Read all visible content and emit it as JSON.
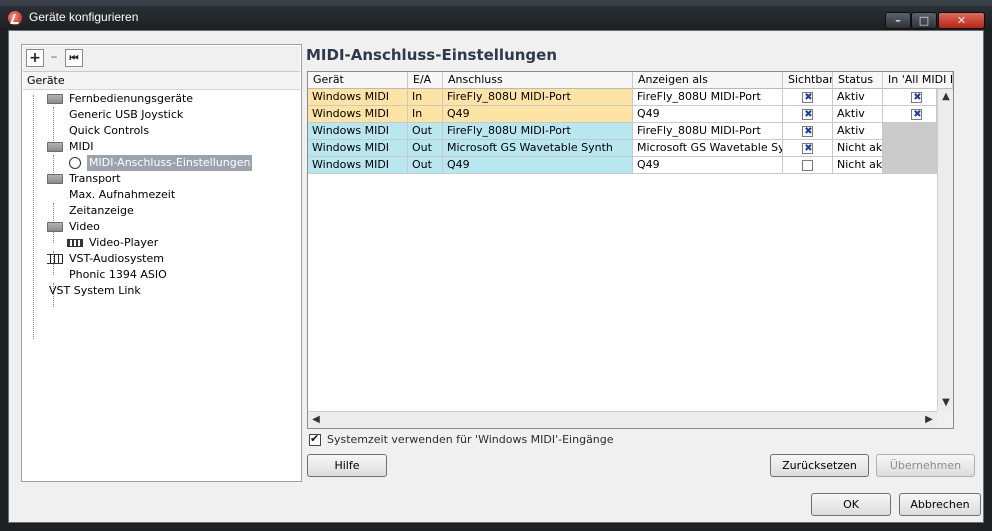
{
  "window": {
    "title": "Geräte konfigurieren",
    "controls": {
      "minimize": "–",
      "maximize": "□",
      "close": "✕"
    }
  },
  "toolbar": {
    "add": "+",
    "remove": "–",
    "reset": "⏮"
  },
  "tree": {
    "header": "Geräte",
    "items": [
      {
        "label": "Fernbedienungsgeräte",
        "icon": "folder-icon"
      },
      {
        "label": "Generic   USB  Joystick"
      },
      {
        "label": "Quick Controls"
      },
      {
        "label": "MIDI",
        "icon": "folder-icon"
      },
      {
        "label": "MIDI-Anschluss-Einstellungen",
        "icon": "midi-port-icon",
        "selected": true
      },
      {
        "label": "Transport",
        "icon": "folder-icon"
      },
      {
        "label": "Max. Aufnahmezeit"
      },
      {
        "label": "Zeitanzeige"
      },
      {
        "label": "Video",
        "icon": "folder-icon"
      },
      {
        "label": "Video-Player",
        "icon": "video-icon"
      },
      {
        "label": "VST-Audiosystem",
        "icon": "vst-icon"
      },
      {
        "label": "Phonic 1394 ASIO"
      },
      {
        "label": "VST System Link"
      }
    ]
  },
  "main": {
    "title": "MIDI-Anschluss-Einstellungen",
    "columns": [
      "Gerät",
      "E/A",
      "Anschluss",
      "Anzeigen als",
      "Sichtbar",
      "Status",
      "In 'All MIDI Inputs'"
    ],
    "rows": [
      {
        "geraet": "Windows MIDI",
        "ea": "In",
        "anschluss": "FireFly_808U MIDI-Port",
        "anzeigen": "FireFly_808U MIDI-Port",
        "sichtbar": true,
        "status": "Aktiv",
        "allmidi": true
      },
      {
        "geraet": "Windows MIDI",
        "ea": "In",
        "anschluss": "Q49",
        "anzeigen": "Q49",
        "sichtbar": true,
        "status": "Aktiv",
        "allmidi": true
      },
      {
        "geraet": "Windows MIDI",
        "ea": "Out",
        "anschluss": "FireFly_808U MIDI-Port",
        "anzeigen": "FireFly_808U MIDI-Port",
        "sichtbar": true,
        "status": "Aktiv",
        "allmidi": null
      },
      {
        "geraet": "Windows MIDI",
        "ea": "Out",
        "anschluss": "Microsoft GS Wavetable Synth",
        "anzeigen": "Microsoft GS Wavetable Synth",
        "sichtbar": true,
        "status": "Nicht aktiv",
        "allmidi": null
      },
      {
        "geraet": "Windows MIDI",
        "ea": "Out",
        "anschluss": "Q49",
        "anzeigen": "Q49",
        "sichtbar": false,
        "status": "Nicht aktiv",
        "allmidi": null
      }
    ],
    "system_time_label": "Systemzeit verwenden für 'Windows MIDI'-Eingänge",
    "system_time_checked": true,
    "help_button": "Hilfe",
    "reset_button": "Zurücksetzen",
    "apply_button": "Übernehmen"
  },
  "footer": {
    "ok_button": "OK",
    "cancel_button": "Abbrechen"
  },
  "colors": {
    "in_row": "#fde3a4",
    "out_row": "#b9e7ef",
    "selected": "#9ba3ac",
    "title_text": "#2c3a4a"
  }
}
